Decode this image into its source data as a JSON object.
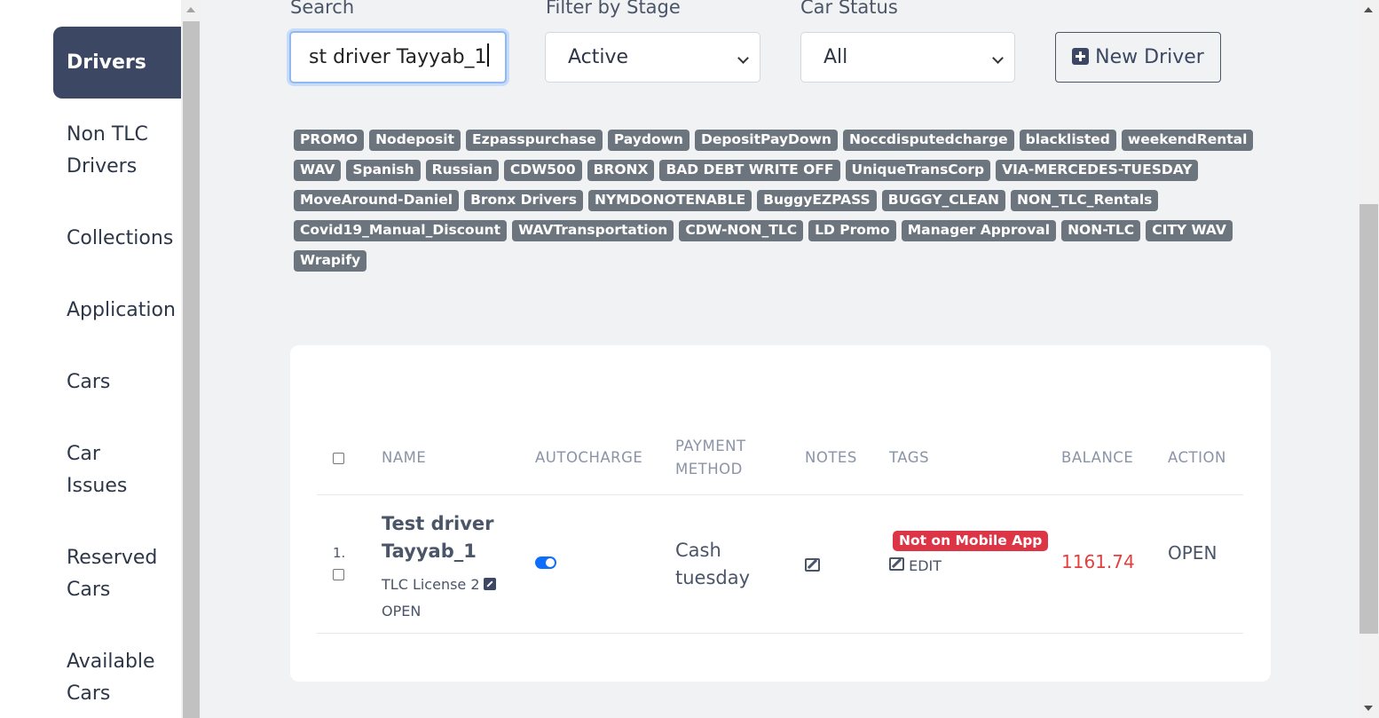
{
  "sidebar": {
    "items": [
      {
        "label": "Drivers",
        "active": true
      },
      {
        "label": "Non TLC\nDrivers"
      },
      {
        "label": "Collections"
      },
      {
        "label": "Application"
      },
      {
        "label": "Cars"
      },
      {
        "label": "Car\nIssues"
      },
      {
        "label": "Reserved\nCars"
      },
      {
        "label": "Available\nCars"
      }
    ]
  },
  "filters": {
    "search_label": "Search",
    "search_value": "st driver Tayyab_1",
    "stage_label": "Filter by Stage",
    "stage_value": "Active",
    "car_status_label": "Car Status",
    "car_status_value": "All",
    "new_driver_label": "New Driver"
  },
  "tags": [
    "PROMO",
    "Nodeposit",
    "Ezpasspurchase",
    "Paydown",
    "DepositPayDown",
    "Noccdisputedcharge",
    "blacklisted",
    "weekendRental",
    "WAV",
    "Spanish",
    "Russian",
    "CDW500",
    "BRONX",
    "BAD DEBT WRITE OFF",
    "UniqueTransCorp",
    "VIA-MERCEDES-TUESDAY",
    "MoveAround-Daniel",
    "Bronx Drivers",
    "NYMDONOTENABLE",
    "BuggyEZPASS",
    "BUGGY_CLEAN",
    "NON_TLC_Rentals",
    "Covid19_Manual_Discount",
    "WAVTransportation ",
    "CDW-NON_TLC",
    "LD Promo",
    "Manager Approval",
    "NON-TLC",
    "CITY WAV",
    "Wrapify"
  ],
  "table": {
    "headers": {
      "name": "NAME",
      "autocharge": "AUTOCHARGE",
      "payment_method_1": "PAYMENT",
      "payment_method_2": "METHOD",
      "notes": "NOTES",
      "tags": "TAGS",
      "balance": "BALANCE",
      "action": "ACTION"
    },
    "rows": [
      {
        "index": "1.",
        "name_line1": "Test driver",
        "name_line2": "Tayyab_1",
        "license": "TLC License 2",
        "status": "OPEN",
        "autocharge": true,
        "payment_line1": "Cash",
        "payment_line2": "tuesday",
        "tag_badge": "Not on Mobile App",
        "edit_label": "EDIT",
        "balance": "1161.74",
        "action": "OPEN"
      }
    ]
  },
  "colors": {
    "sidebar_active": "#3b4763",
    "tag_bg": "#6c757d",
    "badge_red": "#dc3545",
    "balance_red": "#e53e3e",
    "toggle_on": "#0d6efd"
  }
}
